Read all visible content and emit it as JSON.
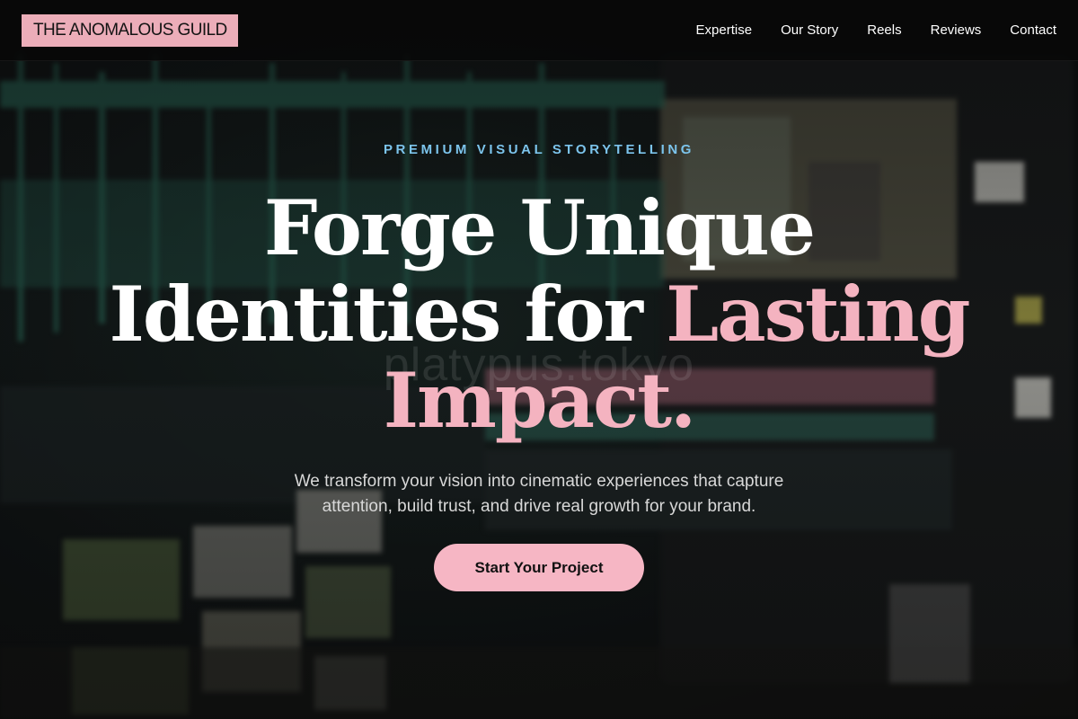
{
  "nav": {
    "logo": "THE ANOMALOUS GUILD",
    "links": [
      "Expertise",
      "Our Story",
      "Reels",
      "Reviews",
      "Contact"
    ]
  },
  "hero": {
    "eyebrow": "PREMIUM VISUAL STORYTELLING",
    "headline": {
      "line1": "Forge Unique",
      "line2_plain": "Identities for ",
      "line2_accent": "Lasting",
      "line3_accent": "Impact."
    },
    "watermark": "platypus.tokyo",
    "subtext_line1": "We transform your vision into cinematic experiences that capture",
    "subtext_line2": "attention, build trust, and drive real growth for your brand.",
    "cta_label": "Start Your Project"
  },
  "colors": {
    "logo_background": "#ecadb9",
    "eyebrow": "#7cc4ec",
    "accent_pink": "#f4b3c0",
    "cta_background": "#f6b6c4",
    "navbar_background": "#080808"
  }
}
